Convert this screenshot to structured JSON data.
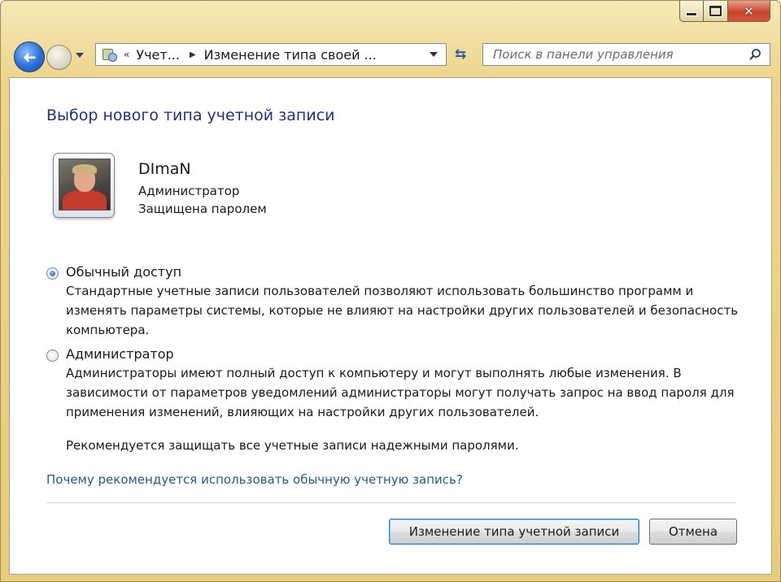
{
  "window": {
    "caption": {
      "minimize_icon": "minimize-icon",
      "maximize_icon": "maximize-icon",
      "close_icon": "close-icon",
      "close_glyph": "✕"
    }
  },
  "navbar": {
    "back_icon": "arrow-left-icon",
    "back_glyph": "➜",
    "breadcrumb": [
      "Учет...",
      "Изменение типа своей ..."
    ],
    "breadcrumb_separator": "«",
    "breadcrumb_arrow": "▶",
    "refresh_glyph": "⇆",
    "search": {
      "placeholder": "Поиск в панели управления",
      "value": ""
    }
  },
  "main": {
    "title": "Выбор нового типа учетной записи",
    "user": {
      "name": "DImaN",
      "role": "Администратор",
      "status": "Защищена паролем"
    },
    "options": [
      {
        "label": "Обычный доступ",
        "checked": true,
        "description": "Стандартные учетные записи пользователей позволяют использовать большинство программ и изменять параметры системы, которые не влияют на настройки других пользователей и безопасность компьютера."
      },
      {
        "label": "Администратор",
        "checked": false,
        "description": "Администраторы имеют полный доступ к компьютеру и могут выполнять любые изменения. В зависимости от параметров уведомлений администраторы могут получать запрос на ввод пароля для применения изменений, влияющих на настройки других пользователей."
      }
    ],
    "recommendation": "Рекомендуется защищать все учетные записи надежными паролями.",
    "link": "Почему рекомендуется использовать обычную учетную запись?",
    "buttons": {
      "change": "Изменение типа учетной записи",
      "cancel": "Отмена"
    }
  },
  "colors": {
    "title": "#1e3287",
    "link": "#1f5aa0",
    "frame": "#e7cd7c"
  }
}
